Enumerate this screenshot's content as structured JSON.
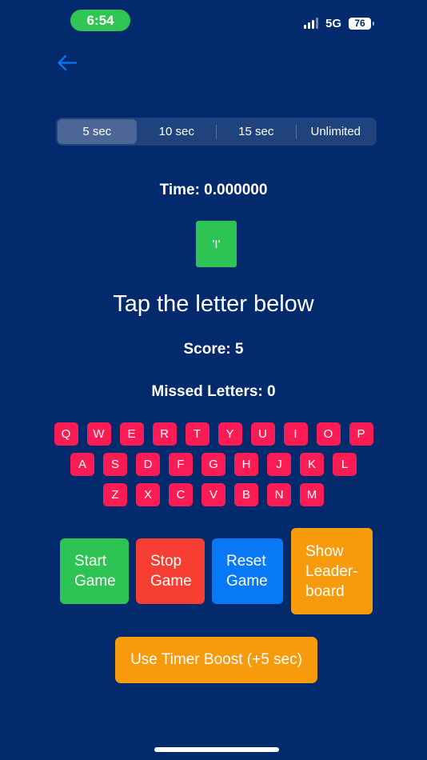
{
  "status_bar": {
    "time": "6:54",
    "network": "5G",
    "battery": "76"
  },
  "colors": {
    "background": "#032a6c",
    "accent_blue": "#0879f6",
    "key_pink": "#fb1c55",
    "green": "#2ec453",
    "red": "#f73e33",
    "orange": "#f79a0b"
  },
  "segments": [
    {
      "label": "5 sec",
      "selected": true
    },
    {
      "label": "10 sec",
      "selected": false
    },
    {
      "label": "15 sec",
      "selected": false
    },
    {
      "label": "Unlimited",
      "selected": false
    }
  ],
  "game": {
    "timer": "Time: 0.000000",
    "current_letter": "'I'",
    "prompt": "Tap the letter below",
    "score": "Score: 5",
    "missed": "Missed Letters: 0"
  },
  "keyboard": {
    "row1": [
      "Q",
      "W",
      "E",
      "R",
      "T",
      "Y",
      "U",
      "I",
      "O",
      "P"
    ],
    "row2": [
      "A",
      "S",
      "D",
      "F",
      "G",
      "H",
      "J",
      "K",
      "L"
    ],
    "row3": [
      "Z",
      "X",
      "C",
      "V",
      "B",
      "N",
      "M"
    ]
  },
  "buttons": {
    "start_line1": "Start",
    "start_line2": "Game",
    "stop_line1": "Stop",
    "stop_line2": "Game",
    "reset_line1": "Reset",
    "reset_line2": "Game",
    "leader_line1": "Show",
    "leader_line2": "Leader-",
    "leader_line3": "board",
    "boost": "Use Timer Boost (+5 sec)"
  },
  "icons": {
    "back": "arrow-left-icon",
    "signal": "cellular-signal-icon",
    "battery": "battery-icon"
  }
}
